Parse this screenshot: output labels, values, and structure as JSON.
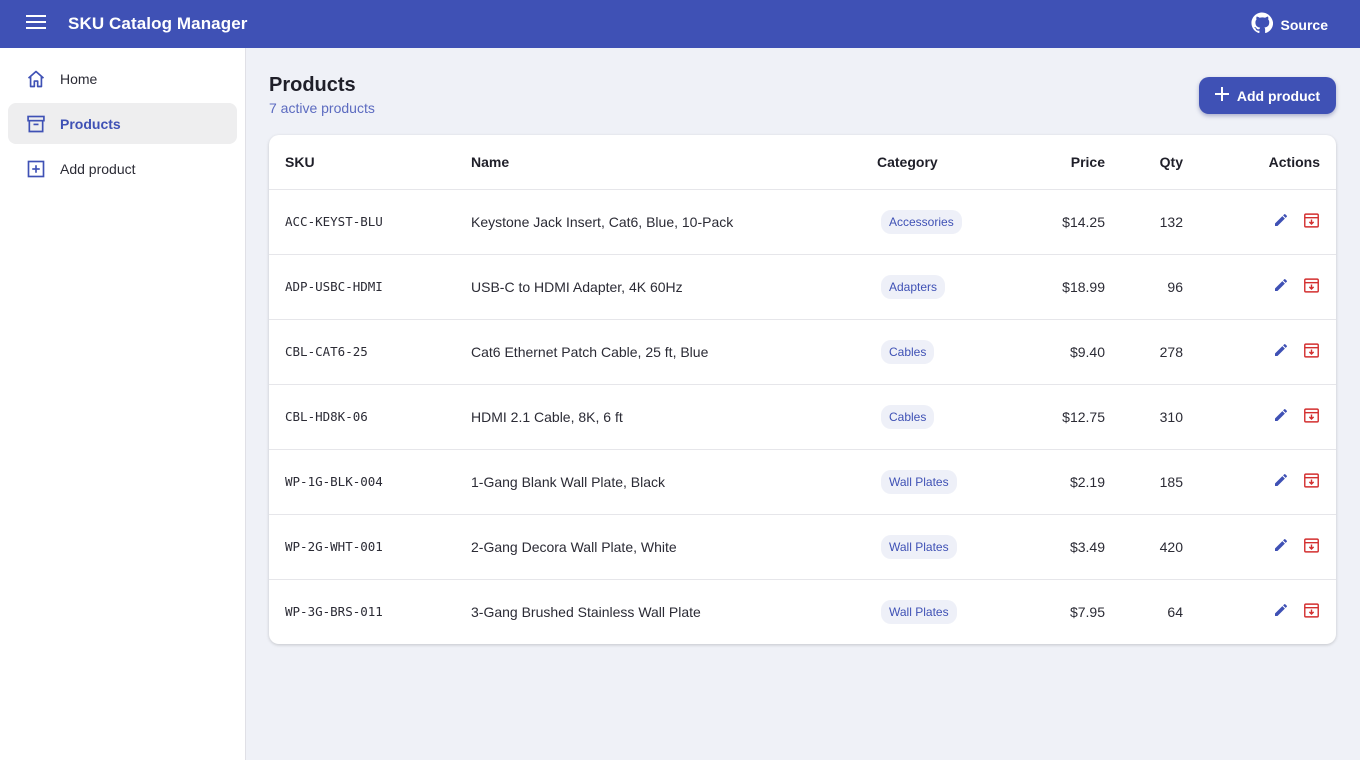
{
  "appbar": {
    "title": "SKU Catalog Manager",
    "source_label": "Source"
  },
  "sidebar": {
    "items": [
      {
        "label": "Home",
        "icon": "home-icon",
        "active": false
      },
      {
        "label": "Products",
        "icon": "archive-icon",
        "active": true
      },
      {
        "label": "Add product",
        "icon": "add-box-icon",
        "active": false
      }
    ]
  },
  "main": {
    "title": "Products",
    "subtitle": "7 active products",
    "add_button_label": "Add product"
  },
  "table": {
    "headers": {
      "sku": "SKU",
      "name": "Name",
      "category": "Category",
      "price": "Price",
      "qty": "Qty",
      "actions": "Actions"
    },
    "rows": [
      {
        "sku": "ACC-KEYST-BLU",
        "name": "Keystone Jack Insert, Cat6, Blue, 10-Pack",
        "category": "Accessories",
        "price": "$14.25",
        "qty": "132"
      },
      {
        "sku": "ADP-USBC-HDMI",
        "name": "USB-C to HDMI Adapter, 4K 60Hz",
        "category": "Adapters",
        "price": "$18.99",
        "qty": "96"
      },
      {
        "sku": "CBL-CAT6-25",
        "name": "Cat6 Ethernet Patch Cable, 25 ft, Blue",
        "category": "Cables",
        "price": "$9.40",
        "qty": "278"
      },
      {
        "sku": "CBL-HD8K-06",
        "name": "HDMI 2.1 Cable, 8K, 6 ft",
        "category": "Cables",
        "price": "$12.75",
        "qty": "310"
      },
      {
        "sku": "WP-1G-BLK-004",
        "name": "1-Gang Blank Wall Plate, Black",
        "category": "Wall Plates",
        "price": "$2.19",
        "qty": "185"
      },
      {
        "sku": "WP-2G-WHT-001",
        "name": "2-Gang Decora Wall Plate, White",
        "category": "Wall Plates",
        "price": "$3.49",
        "qty": "420"
      },
      {
        "sku": "WP-3G-BRS-011",
        "name": "3-Gang Brushed Stainless Wall Plate",
        "category": "Wall Plates",
        "price": "$7.95",
        "qty": "64"
      }
    ]
  },
  "colors": {
    "primary": "#3f51b5",
    "accent_text": "#5c6bc0",
    "archive_red": "#d32f2f",
    "background": "#eff1f7"
  }
}
